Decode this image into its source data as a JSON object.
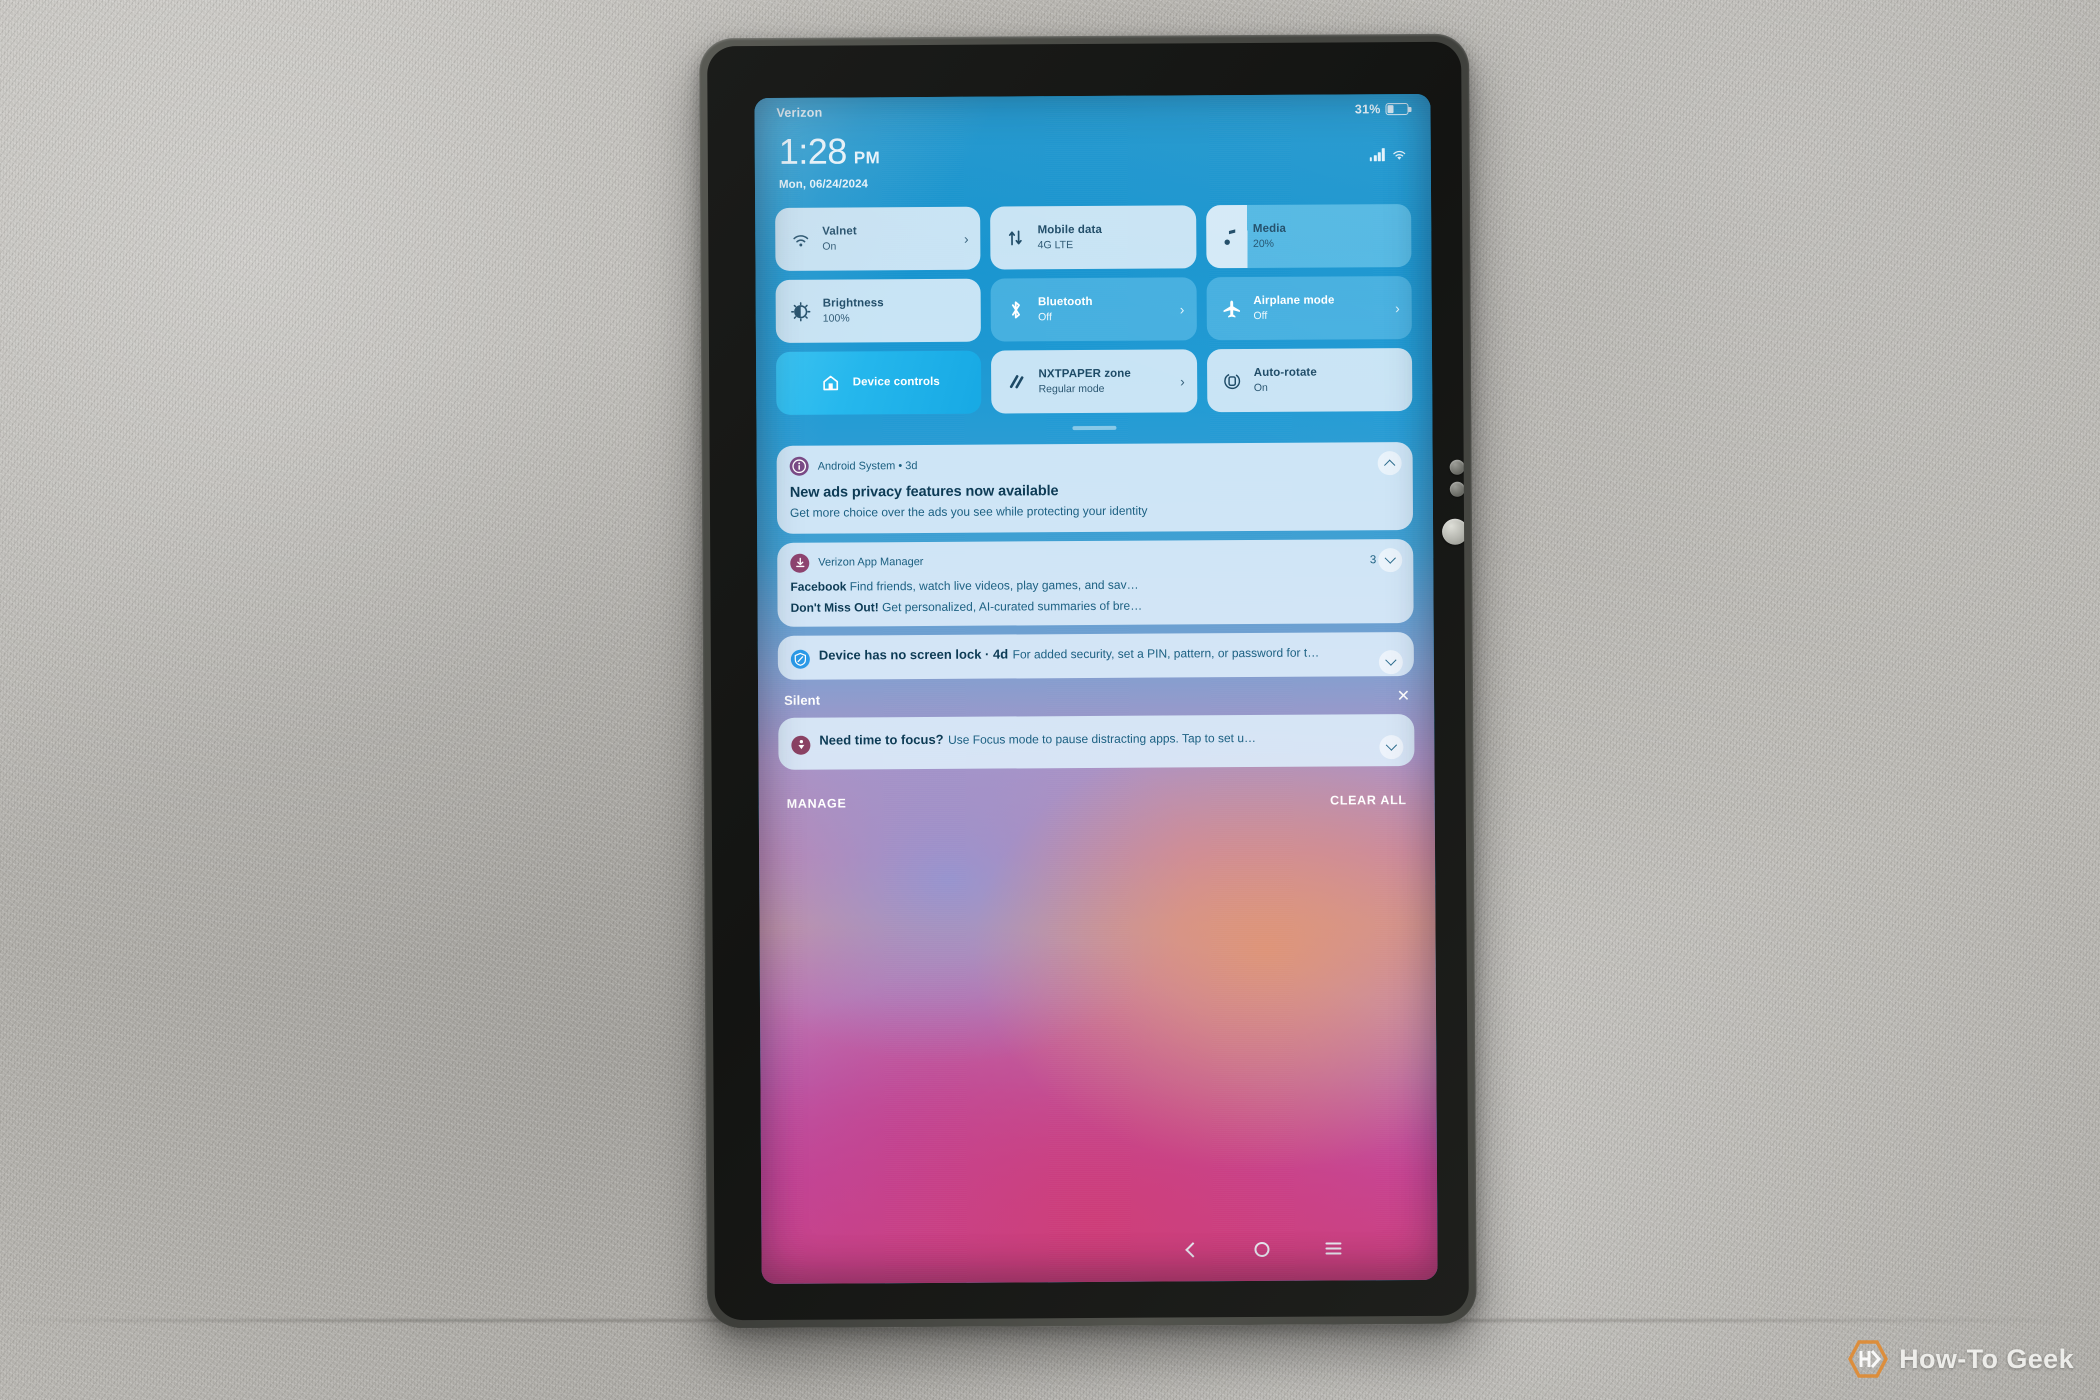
{
  "device": {
    "name": "android-tablet",
    "side_buttons": [
      "sensor-dot",
      "sensor-dot",
      "power-button"
    ]
  },
  "status_bar": {
    "carrier": "Verizon",
    "battery_percent": "31%",
    "battery_level": 31,
    "signal_icon": "cellular-signal-icon",
    "wifi_icon": "wifi-icon",
    "battery_icon": "battery-icon"
  },
  "clock": {
    "time": "1:28",
    "ampm": "PM",
    "date": "Mon, 06/24/2024"
  },
  "quick_settings": {
    "tiles": [
      {
        "label": "Valnet",
        "sub": "On",
        "icon": "wifi-icon",
        "chevron": "›",
        "style": "light",
        "name": "wifi-tile"
      },
      {
        "label": "Mobile data",
        "sub": "4G LTE",
        "icon": "mobile-data-icon",
        "chevron": "",
        "style": "light",
        "name": "mobile-data-tile"
      },
      {
        "label": "Media",
        "sub": "20%",
        "icon": "music-note-icon",
        "chevron": "",
        "style": "slider",
        "name": "media-volume-tile"
      },
      {
        "label": "Brightness",
        "sub": "100%",
        "icon": "brightness-icon",
        "chevron": "",
        "style": "light",
        "name": "brightness-tile"
      },
      {
        "label": "Bluetooth",
        "sub": "Off",
        "icon": "bluetooth-icon",
        "chevron": "›",
        "style": "active",
        "name": "bluetooth-tile"
      },
      {
        "label": "Airplane mode",
        "sub": "Off",
        "icon": "airplane-icon",
        "chevron": "›",
        "style": "active",
        "name": "airplane-mode-tile"
      },
      {
        "label": "Device controls",
        "sub": "",
        "icon": "home-icon",
        "chevron": "",
        "style": "strong",
        "name": "device-controls-tile"
      },
      {
        "label": "NXTPAPER zone",
        "sub": "Regular mode",
        "icon": "nxtpaper-icon",
        "chevron": "›",
        "style": "light",
        "name": "nxtpaper-zone-tile"
      },
      {
        "label": "Auto-rotate",
        "sub": "On",
        "icon": "auto-rotate-icon",
        "chevron": "",
        "style": "light",
        "name": "auto-rotate-tile"
      }
    ],
    "media_fill_percent": 20
  },
  "notifications": {
    "android_system": {
      "app": "Android System • 3d",
      "title": "New ads privacy features now available",
      "body": "Get more choice over the ads you see while protecting your identity",
      "icon": "info-icon",
      "icon_color": "#7a4a86",
      "expand_state": "collapse-icon"
    },
    "verizon_group": {
      "app": "Verizon App Manager",
      "count": "3",
      "icon": "download-icon",
      "icon_color": "#8e4470",
      "expand_state": "expand-icon",
      "items": [
        {
          "title": "Facebook",
          "body": "Find friends, watch live videos, play games, and sav…"
        },
        {
          "title": "Don't Miss Out!",
          "body": "Get personalized, AI-curated summaries of bre…"
        }
      ]
    },
    "screen_lock": {
      "title": "Device has no screen lock · 4d",
      "body": "For added security, set a PIN, pattern, or password for t…",
      "icon": "shield-icon",
      "icon_color": "#2b9ae8",
      "expand_state": "expand-icon"
    },
    "silent_section": {
      "label": "Silent",
      "dismiss_icon": "close-icon",
      "items": [
        {
          "title": "Need time to focus?",
          "body": "Use Focus mode to pause distracting apps. Tap to set u…",
          "icon": "focus-person-icon",
          "icon_color": "#8b4264",
          "expand_state": "expand-icon"
        }
      ]
    },
    "actions": {
      "manage": "MANAGE",
      "clear_all": "CLEAR ALL"
    }
  },
  "navigation_bar": {
    "back": "back-icon",
    "home": "home-circle-icon",
    "recents": "recents-icon"
  },
  "watermark": {
    "text": "How-To Geek",
    "logo": "how-to-geek-logo"
  },
  "colors": {
    "accent_blue": "#1392ce",
    "tile_light": "#dbecf8",
    "tile_active": "#60bee8",
    "notification_bg": "#daebf9",
    "text_dark": "#0d3b55",
    "text_body": "#1d6183",
    "watermark_orange": "#e08b33"
  }
}
